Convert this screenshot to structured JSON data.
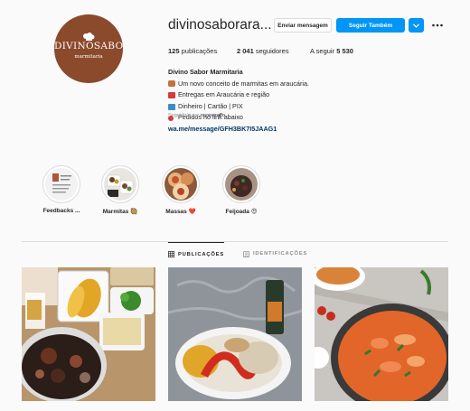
{
  "profile": {
    "username": "divinosaborara...",
    "avatar_logo_text": "DIVINOSABOR",
    "avatar_logo_sub": "marmitaria",
    "buttons": {
      "message": "Enviar mensagem",
      "follow": "Seguir Também"
    },
    "stats": {
      "posts_count": "125",
      "posts_label": "publicações",
      "followers_count": "2 041",
      "followers_label": "seguidores",
      "following_label": "A seguir",
      "following_count": "5 530"
    },
    "bio": {
      "name": "Divino Sabor Marmitaria",
      "lines": [
        {
          "icon": "bento-box-icon",
          "text": "Um novo conceito de marmitas em araucária."
        },
        {
          "icon": "delivery-truck-icon",
          "text": "Entregas em Araucária e região"
        },
        {
          "icon": "money-icon",
          "text": "Dinheiro | Cartão | PIX"
        },
        {
          "icon": "pushpin-icon",
          "text": "Pedidos no link abaixo"
        }
      ],
      "link": "wa.me/message/GFH3BK7I5JAAG1"
    },
    "followed_by": {
      "prefix": "Seguido/a por",
      "user": "rayssaraffo"
    }
  },
  "highlights": [
    {
      "label": "Feedbacks ..."
    },
    {
      "label": "Marmitas 🥘"
    },
    {
      "label": "Massas ❤️"
    },
    {
      "label": "Feijoada 😍"
    }
  ],
  "tabs": {
    "posts": "PUBLICAÇÕES",
    "tagged": "IDENTIFICAÇÕES"
  },
  "colors": {
    "accent": "#0095f6",
    "avatar_bg": "#8b4a2b",
    "link": "#00376b"
  }
}
